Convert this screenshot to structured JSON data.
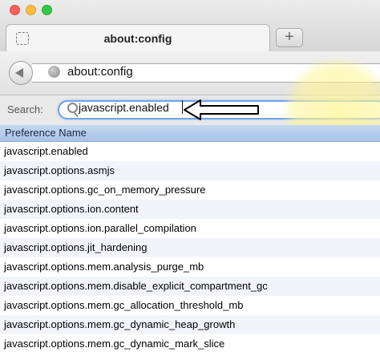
{
  "window": {
    "tab_title": "about:config",
    "new_tab_label": "+"
  },
  "navigation": {
    "url": "about:config"
  },
  "search": {
    "label": "Search:",
    "value": "javascript.enabled"
  },
  "preferences": {
    "column_header": "Preference Name",
    "rows": [
      "javascript.enabled",
      "javascript.options.asmjs",
      "javascript.options.gc_on_memory_pressure",
      "javascript.options.ion.content",
      "javascript.options.ion.parallel_compilation",
      "javascript.options.jit_hardening",
      "javascript.options.mem.analysis_purge_mb",
      "javascript.options.mem.disable_explicit_compartment_gc",
      "javascript.options.mem.gc_allocation_threshold_mb",
      "javascript.options.mem.gc_dynamic_heap_growth",
      "javascript.options.mem.gc_dynamic_mark_slice"
    ]
  },
  "icons": {
    "back": "back-arrow-icon",
    "site": "globe-icon",
    "search": "magnifier-icon",
    "tab": "tab-placeholder-icon",
    "annotation": "left-arrow-pointer-icon"
  },
  "colors": {
    "search_focus": "#6fa5e6",
    "header_blue": "#b4cceb",
    "highlight_yellow": "#fff496"
  }
}
